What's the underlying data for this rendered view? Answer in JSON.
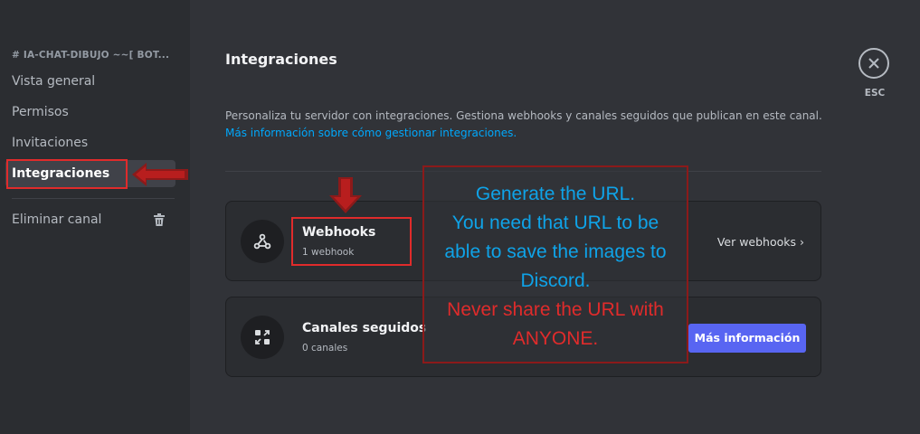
{
  "sidebar": {
    "header": "# IA-CHAT-DIBUJO ~~[ BOT...",
    "items": [
      {
        "label": "Vista general"
      },
      {
        "label": "Permisos"
      },
      {
        "label": "Invitaciones"
      },
      {
        "label": "Integraciones"
      }
    ],
    "delete_label": "Eliminar canal"
  },
  "main": {
    "title": "Integraciones",
    "description": "Personaliza tu servidor con integraciones. Gestiona webhooks y canales seguidos que publican en este canal.",
    "link": "Más información sobre cómo gestionar integraciones.",
    "webhooks": {
      "title": "Webhooks",
      "subtitle": "1 webhook",
      "action": "Ver webhooks ›"
    },
    "followed": {
      "title": "Canales seguidos",
      "subtitle": "0 canales",
      "button": "Más información"
    },
    "esc": "ESC"
  },
  "annotation": {
    "line1": "Generate the URL.",
    "line2": "You need that URL to be",
    "line3": "able to save the images to",
    "line4": "Discord.",
    "warn1": "Never share the URL with",
    "warn2": "ANYONE."
  },
  "colors": {
    "accent": "#5865f2",
    "link": "#00a8fc",
    "annotation_red": "#e02b2b",
    "annotation_blue": "#0fa3e8"
  }
}
